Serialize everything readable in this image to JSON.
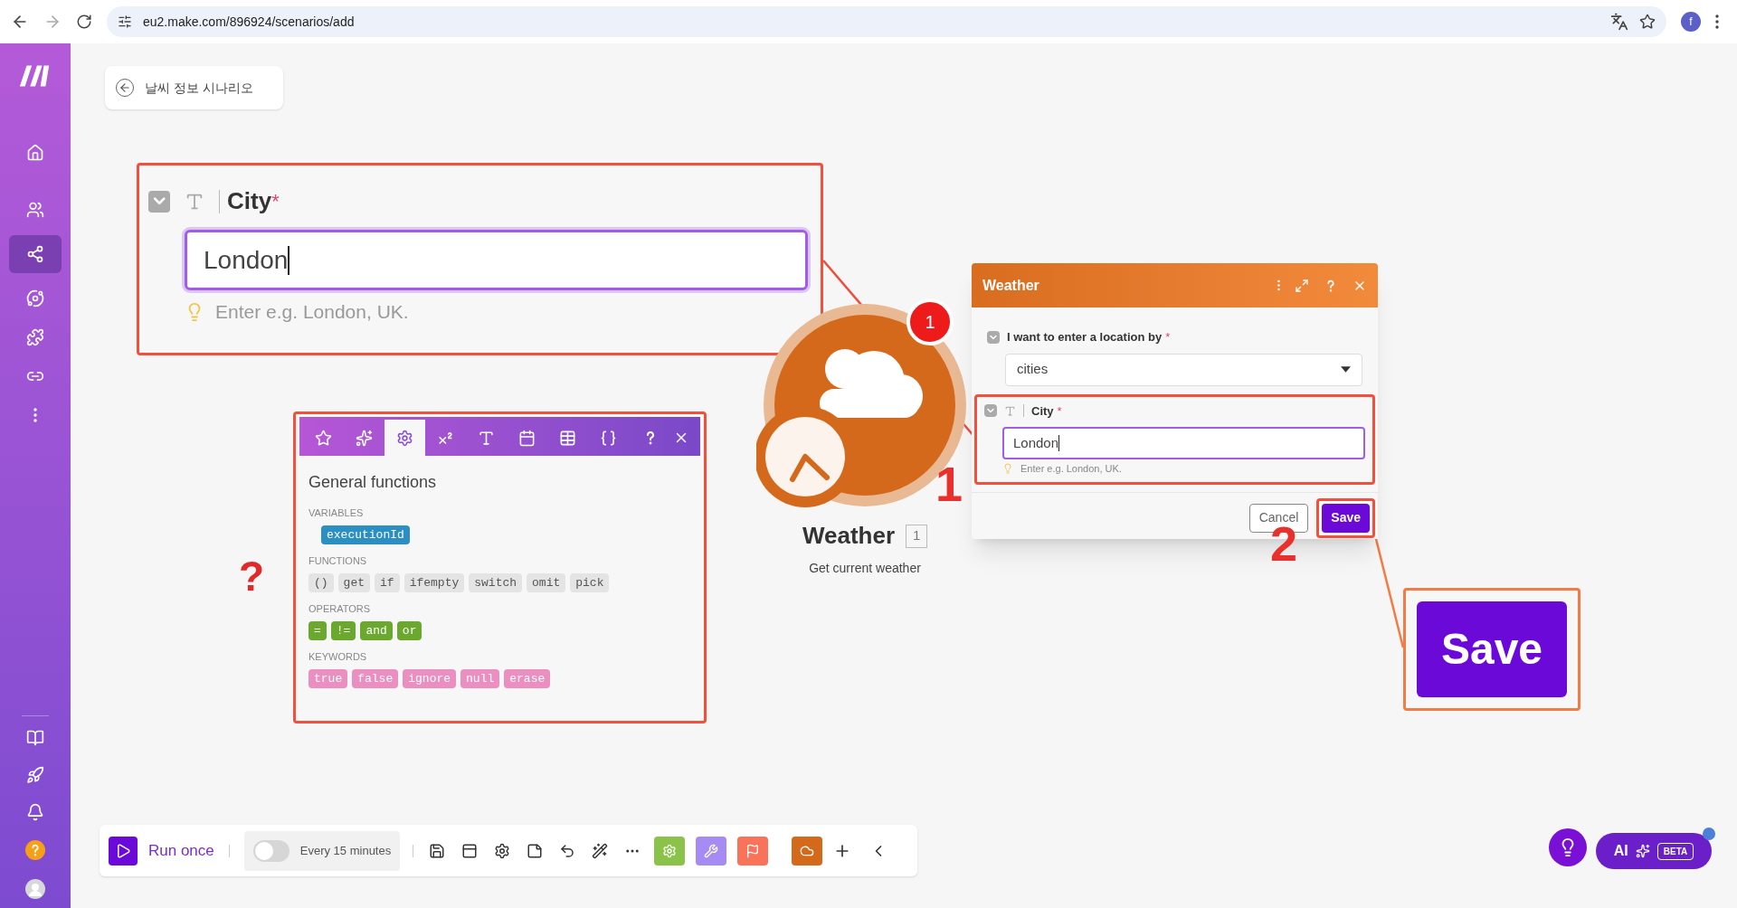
{
  "browser": {
    "url": "eu2.make.com/896924/scenarios/add",
    "profile_initial": "f"
  },
  "sidebar": {
    "top_items": [
      {
        "kind": "home",
        "selected": false
      },
      {
        "kind": "team",
        "selected": false
      },
      {
        "kind": "scenarios",
        "selected": true
      },
      {
        "kind": "ai",
        "selected": false
      },
      {
        "kind": "apps",
        "selected": false
      },
      {
        "kind": "connections",
        "selected": false
      },
      {
        "kind": "more",
        "selected": false
      }
    ],
    "bottom_items": [
      {
        "kind": "docs"
      },
      {
        "kind": "launch"
      },
      {
        "kind": "notifications"
      },
      {
        "kind": "help"
      },
      {
        "kind": "avatar"
      }
    ]
  },
  "scenario": {
    "title": "날씨 정보 시나리오"
  },
  "city_callout": {
    "checked": true,
    "label": "City",
    "required_mark": "*",
    "value": "London",
    "hint": "Enter e.g. London, UK."
  },
  "functions_panel": {
    "tabs": [
      {
        "kind": "star",
        "selected": false
      },
      {
        "kind": "sparkles",
        "selected": false
      },
      {
        "kind": "gear",
        "selected": true
      },
      {
        "kind": "math",
        "selected": false
      },
      {
        "kind": "text",
        "selected": false
      },
      {
        "kind": "calendar",
        "selected": false
      },
      {
        "kind": "table",
        "selected": false
      },
      {
        "kind": "braces",
        "selected": false
      }
    ],
    "title": "General functions",
    "sections": [
      {
        "heading": "VARIABLES",
        "kind": "variable",
        "items": [
          "executionId"
        ]
      },
      {
        "heading": "FUNCTIONS",
        "kind": "function",
        "items": [
          "()",
          "get",
          "if",
          "ifempty",
          "switch",
          "omit",
          "pick"
        ]
      },
      {
        "heading": "OPERATORS",
        "kind": "operator",
        "items": [
          "=",
          "!=",
          "and",
          "or"
        ]
      },
      {
        "heading": "KEYWORDS",
        "kind": "keyword",
        "items": [
          "true",
          "false",
          "ignore",
          "null",
          "erase"
        ]
      }
    ]
  },
  "question_mark": "?",
  "module": {
    "name": "Weather",
    "count": "1",
    "subtitle": "Get current weather",
    "badge": "1"
  },
  "dialog": {
    "title": "Weather",
    "fields": [
      {
        "kind": "select",
        "checked": true,
        "label": "I want to enter a location by",
        "required_mark": "*",
        "value": "cities",
        "highlighted": false
      },
      {
        "kind": "text",
        "checked": true,
        "label": "City",
        "required_mark": "*",
        "value": "London",
        "hint": "Enter e.g. London, UK.",
        "highlighted": true
      }
    ],
    "buttons": [
      {
        "label": "Cancel",
        "kind": "secondary",
        "highlighted": false
      },
      {
        "label": "Save",
        "kind": "primary",
        "highlighted": true
      }
    ]
  },
  "step_labels": [
    "1",
    "2"
  ],
  "save_callout": {
    "label": "Save"
  },
  "toolbar": {
    "run_label": "Run once",
    "schedule": {
      "on": false,
      "label": "Every 15 minutes"
    },
    "tools": [
      {
        "kind": "save"
      },
      {
        "kind": "layout"
      },
      {
        "kind": "settings"
      },
      {
        "kind": "note"
      },
      {
        "kind": "undo"
      },
      {
        "kind": "magic"
      },
      {
        "kind": "more"
      }
    ],
    "modules": [
      {
        "kind": "gear",
        "color": "#8bc34a"
      },
      {
        "kind": "tools",
        "color": "#a78bf5"
      },
      {
        "kind": "flag",
        "color": "#f9735b"
      },
      {
        "kind": "weather",
        "color": "#d4691c"
      }
    ]
  },
  "assistant": {
    "ai_label": "AI",
    "beta_label": "BETA"
  }
}
